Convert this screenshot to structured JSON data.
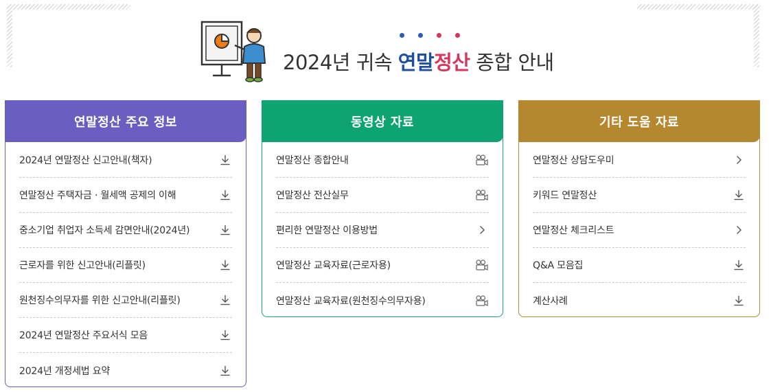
{
  "header": {
    "title_prefix": "2024년 귀속 ",
    "title_highlight1": "연말",
    "title_highlight2": "정산",
    "title_suffix": " 종합 안내",
    "dot_colors": [
      "#2b5cb8",
      "#2b5cb8",
      "#d6365b",
      "#d6365b"
    ]
  },
  "colors": {
    "title_blue": "#1d4fa3",
    "title_red": "#d6365b",
    "panel1": "#6a5fc1",
    "panel2": "#0ea472",
    "panel3": "#b5872f"
  },
  "panels": [
    {
      "title": "연말정산 주요 정보",
      "items": [
        {
          "label": "2024년 연말정산 신고안내(책자)",
          "icon": "download-icon"
        },
        {
          "label": "연말정산 주택자금 · 월세액 공제의 이해",
          "icon": "download-icon"
        },
        {
          "label": "중소기업 취업자 소득세 감면안내(2024년)",
          "icon": "download-icon"
        },
        {
          "label": "근로자를 위한 신고안내(리플릿)",
          "icon": "download-icon"
        },
        {
          "label": "원천징수의무자를 위한 신고안내(리플릿)",
          "icon": "download-icon"
        },
        {
          "label": "2024년 연말정산 주요서식 모음",
          "icon": "download-icon"
        },
        {
          "label": "2024년 개정세법 요약",
          "icon": "download-icon"
        }
      ]
    },
    {
      "title": "동영상 자료",
      "items": [
        {
          "label": "연말정산 종합안내",
          "icon": "video-camera-icon"
        },
        {
          "label": "연말정산 전산실무",
          "icon": "video-camera-icon"
        },
        {
          "label": "편리한 연말정산 이용방법",
          "icon": "chevron-right-icon"
        },
        {
          "label": "연말정산 교육자료(근로자용)",
          "icon": "video-camera-icon"
        },
        {
          "label": "연말정산 교육자료(원천징수의무자용)",
          "icon": "video-camera-icon"
        }
      ]
    },
    {
      "title": "기타 도움 자료",
      "items": [
        {
          "label": "연말정산 상담도우미",
          "icon": "chevron-right-icon"
        },
        {
          "label": "키워드 연말정산",
          "icon": "download-icon"
        },
        {
          "label": "연말정산 체크리스트",
          "icon": "chevron-right-icon"
        },
        {
          "label": "Q&A 모음집",
          "icon": "download-icon"
        },
        {
          "label": "계산사례",
          "icon": "download-icon"
        }
      ]
    }
  ]
}
